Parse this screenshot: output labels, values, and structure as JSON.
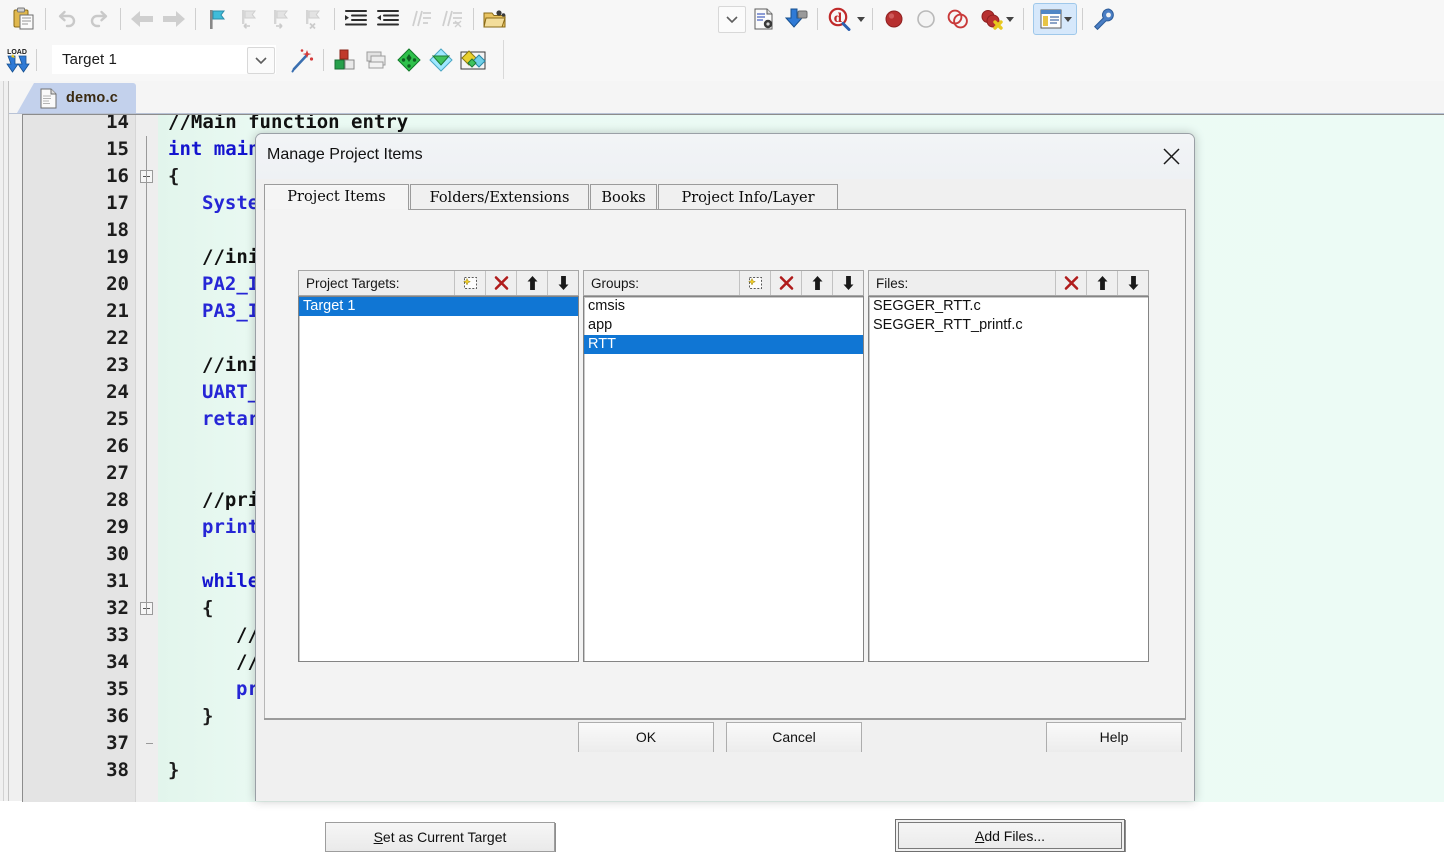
{
  "toolbar_row1": {
    "buttons": [
      {
        "name": "paste-button",
        "icon": "paste-icon",
        "enabled": true
      },
      {
        "name": "undo-button",
        "icon": "undo-icon",
        "enabled": false
      },
      {
        "name": "redo-button",
        "icon": "redo-icon",
        "enabled": false
      },
      {
        "name": "navigate-back-button",
        "icon": "arrow-left-icon",
        "enabled": false
      },
      {
        "name": "navigate-forward-button",
        "icon": "arrow-right-icon",
        "enabled": false
      },
      {
        "name": "toggle-bookmark-button",
        "icon": "bookmark-flag-icon",
        "enabled": true
      },
      {
        "name": "previous-bookmark-button",
        "icon": "bookmark-prev-icon",
        "enabled": false
      },
      {
        "name": "next-bookmark-button",
        "icon": "bookmark-next-icon",
        "enabled": false
      },
      {
        "name": "clear-bookmarks-button",
        "icon": "bookmark-clear-icon",
        "enabled": false
      },
      {
        "name": "indent-button",
        "icon": "indent-right-icon",
        "enabled": true
      },
      {
        "name": "outdent-button",
        "icon": "indent-left-icon",
        "enabled": true
      },
      {
        "name": "comment-button",
        "icon": "comment-lines-icon",
        "enabled": false
      },
      {
        "name": "uncomment-button",
        "icon": "uncomment-lines-icon",
        "enabled": false
      },
      {
        "name": "open-file-button",
        "icon": "open-folder-icon",
        "enabled": true
      },
      {
        "name": "combo-dropdown-button",
        "icon": "chevron-down-icon",
        "enabled": true
      },
      {
        "name": "configure-target-button",
        "icon": "document-settings-icon",
        "enabled": true
      },
      {
        "name": "download-button",
        "icon": "download-arrow-icon",
        "enabled": true
      },
      {
        "name": "start-debug-button",
        "icon": "debug-magnifier-icon",
        "enabled": true
      },
      {
        "name": "debug-dropdown-button",
        "icon": "caret-down-icon",
        "enabled": true
      },
      {
        "name": "insert-breakpoint-button",
        "icon": "red-circle-filled-icon",
        "enabled": true
      },
      {
        "name": "kill-breakpoint-button",
        "icon": "circle-outline-icon",
        "enabled": true
      },
      {
        "name": "disable-breakpoint-button",
        "icon": "two-circles-icon",
        "enabled": true
      },
      {
        "name": "kill-all-breakpoints-button",
        "icon": "breakpoint-delete-icon",
        "enabled": true
      },
      {
        "name": "breakpoints-dropdown-button",
        "icon": "caret-down-icon",
        "enabled": true
      },
      {
        "name": "project-window-button",
        "icon": "project-window-icon",
        "enabled": true,
        "active": true
      },
      {
        "name": "project-window-dropdown",
        "icon": "caret-down-icon",
        "enabled": true
      },
      {
        "name": "configure-toolbar-button",
        "icon": "wrench-icon",
        "enabled": true
      }
    ]
  },
  "toolbar_row2": {
    "load_button": {
      "label": "LOAD",
      "name": "download-flash-button"
    },
    "target_select": {
      "value": "Target 1",
      "name": "target-select"
    },
    "buttons": [
      {
        "name": "target-options-button",
        "icon": "magic-wand-icon"
      },
      {
        "name": "manage-project-items-button",
        "icon": "project-blocks-icon"
      },
      {
        "name": "manage-multi-project-button",
        "icon": "multi-windows-icon"
      },
      {
        "name": "pack-installer-button",
        "icon": "green-diamond-icon"
      },
      {
        "name": "manage-run-time-button",
        "icon": "diamond-funnel-icon"
      },
      {
        "name": "select-software-packs-button",
        "icon": "packs-icon"
      }
    ]
  },
  "editor": {
    "tab": {
      "label": "demo.c",
      "icon": "document-icon"
    },
    "lines": [
      {
        "num": "14",
        "tokens": [
          {
            "t": "//Main function entry",
            "c": "c-com"
          }
        ],
        "indent": 0,
        "fold": "none"
      },
      {
        "num": "15",
        "tokens": [
          {
            "t": "int main",
            "c": "c-kw"
          }
        ],
        "indent": 0,
        "fold": "none"
      },
      {
        "num": "16",
        "tokens": [
          {
            "t": "{",
            "c": "c-pl"
          }
        ],
        "indent": 0,
        "fold": "open"
      },
      {
        "num": "17",
        "tokens": [
          {
            "t": "Syste",
            "c": "c-id"
          }
        ],
        "indent": 1,
        "fold": "none"
      },
      {
        "num": "18",
        "tokens": [],
        "indent": 0,
        "fold": "none"
      },
      {
        "num": "19",
        "tokens": [
          {
            "t": "//ini",
            "c": "c-com"
          }
        ],
        "indent": 1,
        "fold": "none"
      },
      {
        "num": "20",
        "tokens": [
          {
            "t": "PA2_I",
            "c": "c-id"
          }
        ],
        "indent": 1,
        "fold": "none"
      },
      {
        "num": "21",
        "tokens": [
          {
            "t": "PA3_I",
            "c": "c-id"
          }
        ],
        "indent": 1,
        "fold": "none"
      },
      {
        "num": "22",
        "tokens": [],
        "indent": 0,
        "fold": "none"
      },
      {
        "num": "23",
        "tokens": [
          {
            "t": "//ini",
            "c": "c-com"
          }
        ],
        "indent": 1,
        "fold": "none"
      },
      {
        "num": "24",
        "tokens": [
          {
            "t": "UART_",
            "c": "c-id"
          }
        ],
        "indent": 1,
        "fold": "none"
      },
      {
        "num": "25",
        "tokens": [
          {
            "t": "retar",
            "c": "c-id"
          }
        ],
        "indent": 1,
        "fold": "none"
      },
      {
        "num": "26",
        "tokens": [],
        "indent": 0,
        "fold": "none"
      },
      {
        "num": "27",
        "tokens": [],
        "indent": 0,
        "fold": "none"
      },
      {
        "num": "28",
        "tokens": [
          {
            "t": "//pri",
            "c": "c-com"
          }
        ],
        "indent": 1,
        "fold": "none"
      },
      {
        "num": "29",
        "tokens": [
          {
            "t": "print",
            "c": "c-id"
          }
        ],
        "indent": 1,
        "fold": "none"
      },
      {
        "num": "30",
        "tokens": [],
        "indent": 0,
        "fold": "none"
      },
      {
        "num": "31",
        "tokens": [
          {
            "t": "while",
            "c": "c-kw"
          }
        ],
        "indent": 1,
        "fold": "none"
      },
      {
        "num": "32",
        "tokens": [
          {
            "t": "{",
            "c": "c-pl"
          }
        ],
        "indent": 1,
        "fold": "open"
      },
      {
        "num": "33",
        "tokens": [
          {
            "t": "//s",
            "c": "c-com"
          }
        ],
        "indent": 2,
        "fold": "none"
      },
      {
        "num": "34",
        "tokens": [
          {
            "t": "//s",
            "c": "c-com"
          }
        ],
        "indent": 2,
        "fold": "none"
      },
      {
        "num": "35",
        "tokens": [
          {
            "t": "pri",
            "c": "c-id"
          }
        ],
        "indent": 2,
        "fold": "none"
      },
      {
        "num": "36",
        "tokens": [
          {
            "t": "}",
            "c": "c-pl"
          }
        ],
        "indent": 1,
        "fold": "none"
      },
      {
        "num": "37",
        "tokens": [],
        "indent": 0,
        "fold": "end"
      },
      {
        "num": "38",
        "tokens": [
          {
            "t": "}",
            "c": "c-pl"
          }
        ],
        "indent": 0,
        "fold": "none"
      }
    ]
  },
  "dialog": {
    "title": "Manage Project Items",
    "close_icon": "close-icon",
    "tabs": [
      {
        "label": "Project Items",
        "selected": true
      },
      {
        "label": "Folders/Extensions",
        "selected": false
      },
      {
        "label": "Books",
        "selected": false
      },
      {
        "label": "Project Info/Layer",
        "selected": false
      }
    ],
    "panels": {
      "targets": {
        "title": "Project Targets:",
        "tools": [
          "new-item-icon",
          "delete-icon",
          "move-up-icon",
          "move-down-icon"
        ],
        "items": [
          {
            "label": "Target 1",
            "selected": true
          }
        ]
      },
      "groups": {
        "title": "Groups:",
        "tools": [
          "new-item-icon",
          "delete-icon",
          "move-up-icon",
          "move-down-icon"
        ],
        "items": [
          {
            "label": "cmsis",
            "selected": false
          },
          {
            "label": "app",
            "selected": false
          },
          {
            "label": "RTT",
            "selected": true
          }
        ]
      },
      "files": {
        "title": "Files:",
        "tools": [
          "delete-icon",
          "move-up-icon",
          "move-down-icon"
        ],
        "items": [
          {
            "label": "SEGGER_RTT.c",
            "selected": false
          },
          {
            "label": "SEGGER_RTT_printf.c",
            "selected": false
          }
        ]
      }
    },
    "set_target_button": {
      "accel": "S",
      "rest": "et as Current Target"
    },
    "add_files_button": {
      "pre": "A",
      "accel_rest": "dd Files..."
    },
    "bottom_buttons": [
      {
        "label": "OK"
      },
      {
        "label": "Cancel"
      },
      {
        "label": "Help"
      }
    ]
  },
  "colors": {
    "selection_blue": "#1076d4",
    "editor_bg": "#eafaf3",
    "keyword_blue": "#1414cf",
    "dialog_bg": "#f0f0f0",
    "tab_blue": "#c3d1ec"
  }
}
